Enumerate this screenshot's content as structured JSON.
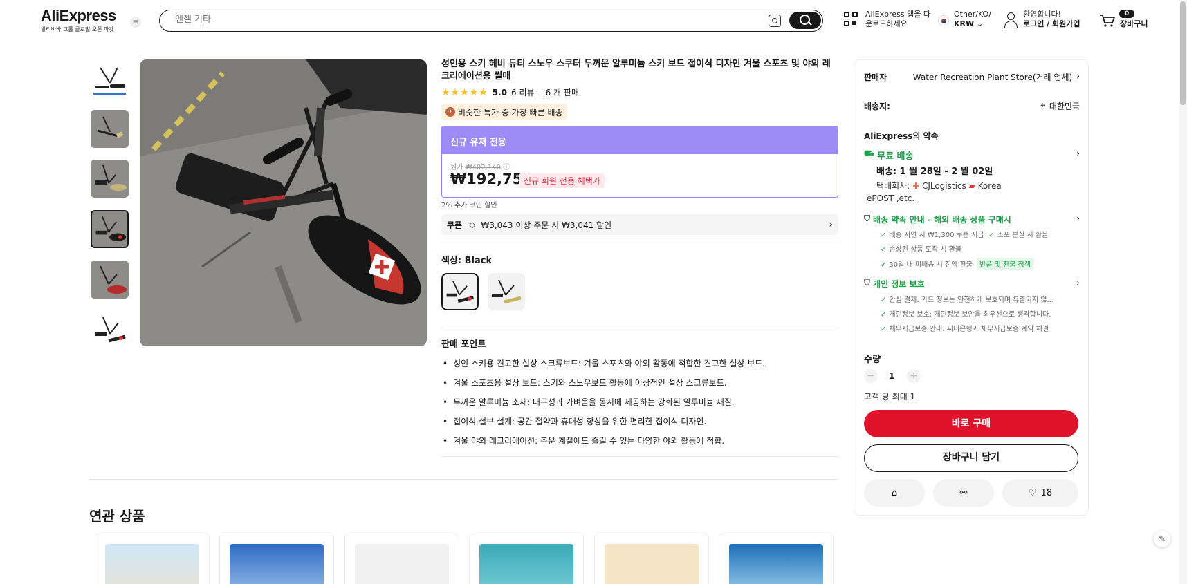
{
  "header": {
    "logo": "AliExpress",
    "logo_sub": "알리바바 그룹 글로벌 오픈 마켓",
    "search_placeholder": "엔젤 기타",
    "app_line1": "AliExpress 앱을 다",
    "app_line2": "운로드하세요",
    "locale_line1": "Other/KO/",
    "locale_line2": "KRW",
    "welcome": "환영합니다!",
    "login": "로그인 / 회원가입",
    "cart_count": "0",
    "cart_label": "장바구니"
  },
  "product": {
    "title": "성인용 스키 헤비 듀티 스노우 스쿠터 두꺼운 알루미늄 스키 보드 접이식 디자인 겨울 스포츠 및 야외 레크리에이션용 썰매",
    "rating": "5.0",
    "reviews": "6 리뷰",
    "sold": "6 개 판매",
    "fast_badge": "비슷한 특가 중 가장 빠른 배송",
    "promo_header": "신규 유저 전용",
    "orig_label": "원가",
    "orig_price": "₩402,140",
    "price": "₩192,755",
    "price_tag": "신규 회원 전용 혜택가",
    "coin_note": "2% 추가 코인 할인",
    "coupon_label": "쿠폰",
    "coupon_text": "₩3,043 이상 주문 시 ₩3,041 할인",
    "color_label": "색상: Black",
    "selling_points_title": "판매 포인트",
    "selling_points": [
      "성인 스키용 견고한 설상 스크류보드: 겨울 스포츠와 야외 활동에 적합한 견고한 설상 보드.",
      "겨울 스포츠용 설상 보드: 스키와 스노우보드 활동에 이상적인 설상 스크류보드.",
      "두꺼운 알루미늄 소재: 내구성과 가벼움을 동시에 제공하는 강화된 알루미늄 재질.",
      "접이식 설보 설계: 공간 절약과 휴대성 향상을 위한 편리한 접이식 디자인.",
      "겨울 야외 레크리에이션: 추운 계절에도 즐길 수 있는 다양한 야외 활동에 적합."
    ]
  },
  "related": {
    "title": "연관 상품"
  },
  "panel": {
    "seller_label": "판매자",
    "seller_name": "Water Recreation Plant Store(거래 업체)",
    "ship_to_label": "배송지:",
    "ship_to": "대한민국",
    "promise_title": "AliExpress의 약속",
    "free_shipping": "무료 배송",
    "delivery": "배송: 1 월 28일 - 2 월 02일",
    "courier_label": "택배회사:",
    "courier1": "CJLogistics",
    "courier2": "Korea",
    "courier3": "ePOST ,etc.",
    "guarantee_title": "배송 약속 안내 - 해외 배송 상품 구매시",
    "guarantee_items": [
      "배송 지연 시 ₩1,300 쿠폰 지급",
      "소포 분실 시 환불",
      "손상된 상품 도착 시 환불",
      "30일 내 미배송 시 전액 환불"
    ],
    "policy_badge": "반품 및 환불 정책",
    "privacy_title": "개인 정보 보호",
    "privacy_items": [
      "안심 결제: 카드 정보는 안전하게 보호되며 유출되지 않...",
      "개인정보 보호: 개인정보 보안을 최우선으로 생각합니다.",
      "채무지급보증 안내: 씨티은행과 채무지급보증 계약 체결"
    ],
    "qty_label": "수량",
    "qty_value": "1",
    "qty_limit": "고객 당 최대 1",
    "buy_now": "바로 구매",
    "add_cart": "장바구니 담기",
    "wish_count": "18"
  },
  "colors": {
    "accent": "#e0112b",
    "promo_purple": "#9d8cf7",
    "green": "#1ba34a",
    "star": "#fdbd2c"
  }
}
